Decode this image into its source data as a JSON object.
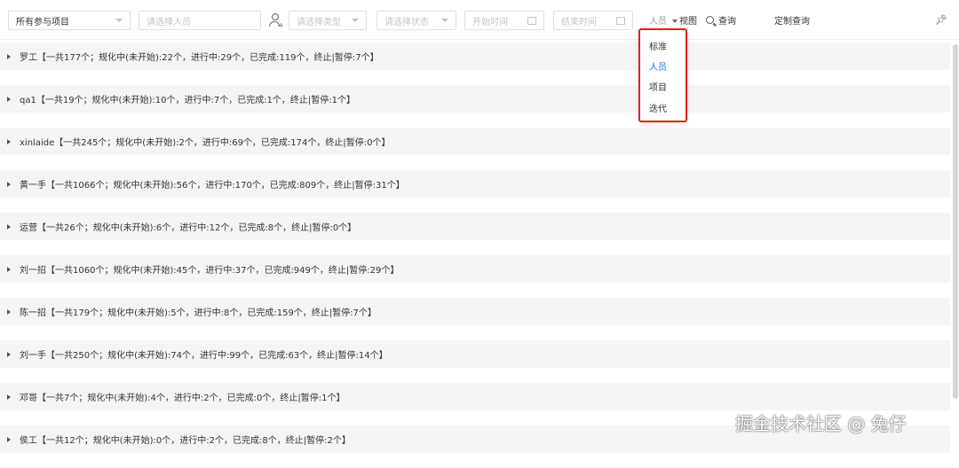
{
  "toolbar": {
    "project_select": "所有参与项目",
    "person_placeholder": "请选择人员",
    "type_placeholder": "请选择类型",
    "status_placeholder": "请选择状态",
    "start_placeholder": "开始时间",
    "end_placeholder": "结束时间",
    "view_current": "人员",
    "view_label": "视图",
    "query_label": "查询",
    "custom_query_label": "定制查询"
  },
  "view_dropdown": {
    "options": [
      {
        "label": "标准",
        "active": false
      },
      {
        "label": "人员",
        "active": true
      },
      {
        "label": "项目",
        "active": false
      },
      {
        "label": "迭代",
        "active": false
      }
    ]
  },
  "rows": [
    {
      "text": "罗工【一共177个；规化中(未开始):22个，进行中:29个，已完成:119个，终止|暂停:7个】"
    },
    {
      "text": "qa1【一共19个；规化中(未开始):10个，进行中:7个，已完成:1个，终止|暂停:1个】"
    },
    {
      "text": "xinlaide【一共245个；规化中(未开始):2个，进行中:69个，已完成:174个，终止|暂停:0个】"
    },
    {
      "text": "黄一手【一共1066个；规化中(未开始):56个，进行中:170个，已完成:809个，终止|暂停:31个】"
    },
    {
      "text": "运营【一共26个；规化中(未开始):6个，进行中:12个，已完成:8个，终止|暂停:0个】"
    },
    {
      "text": "刘一招【一共1060个；规化中(未开始):45个，进行中:37个，已完成:949个，终止|暂停:29个】"
    },
    {
      "text": "陈一招【一共179个；规化中(未开始):5个，进行中:8个，已完成:159个，终止|暂停:7个】"
    },
    {
      "text": "刘一手【一共250个；规化中(未开始):74个，进行中:99个，已完成:63个，终止|暂停:14个】"
    },
    {
      "text": "邓哥【一共7个；规化中(未开始):4个，进行中:2个，已完成:0个，终止|暂停:1个】"
    },
    {
      "text": "侯工【一共12个；规化中(未开始):0个，进行中:2个，已完成:8个，终止|暂停:2个】"
    }
  ],
  "watermark": "掘金技术社区 @ 兔仔",
  "colors": {
    "accent": "#1677ff",
    "highlight_border": "#e02020",
    "row_bg": "#f5f5f5"
  }
}
